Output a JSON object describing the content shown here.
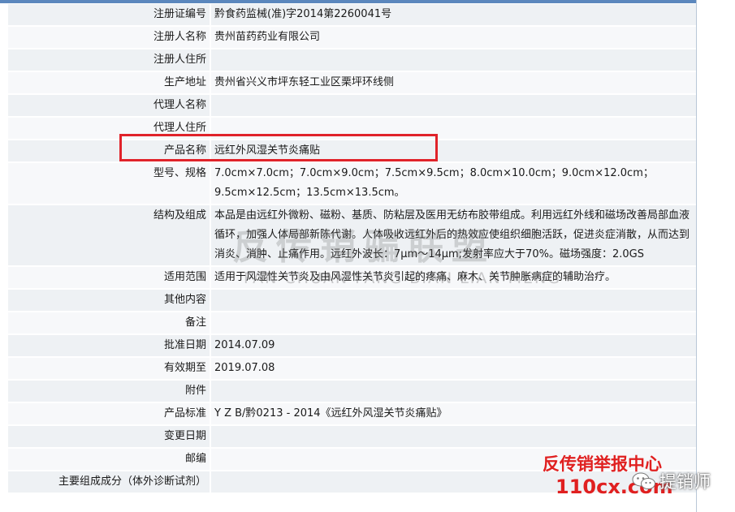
{
  "rows": [
    {
      "label": "注册证编号",
      "value": "黔食药监械(准)字2014第2260041号"
    },
    {
      "label": "注册人名称",
      "value": "贵州苗药药业有限公司"
    },
    {
      "label": "注册人住所",
      "value": ""
    },
    {
      "label": "生产地址",
      "value": "贵州省兴义市坪东轻工业区栗坪环线侧"
    },
    {
      "label": "代理人名称",
      "value": ""
    },
    {
      "label": "代理人住所",
      "value": ""
    },
    {
      "label": "产品名称",
      "value": "远红外风湿关节炎痛贴"
    },
    {
      "label": "型号、规格",
      "value": "7.0cm×7.0cm；7.0cm×9.0cm；7.5cm×9.5cm；8.0cm×10.0cm；9.0cm×12.0cm；9.5cm×12.5cm；13.5cm×13.5cm。"
    },
    {
      "label": "结构及组成",
      "value": "本品是由远红外微粉、磁粉、基质、防粘层及医用无纺布胶带组成。利用远红外线和磁场改善局部血液循环，加强人体局部新陈代谢。人体吸收远红外后的热效应使组织细胞活跃，促进炎症消散，从而达到消炎、消肿、止痛作用。远红外波长：7μm～14μm;发射率应大于70%。磁场强度：2.0GS"
    },
    {
      "label": "适用范围",
      "value": "适用于风湿性关节炎及由风湿性关节炎引起的疼痛、麻木、关节肿胀病症的辅助治疗。"
    },
    {
      "label": "其他内容",
      "value": ""
    },
    {
      "label": "备注",
      "value": ""
    },
    {
      "label": "批准日期",
      "value": "2014.07.09"
    },
    {
      "label": "有效期至",
      "value": "2019.07.08"
    },
    {
      "label": "附件",
      "value": ""
    },
    {
      "label": "产品标准",
      "value": "Y Z B/黔0213 - 2014《远红外风湿关节炎痛贴》"
    },
    {
      "label": "变更日期",
      "value": ""
    },
    {
      "label": "邮编",
      "value": ""
    },
    {
      "label": "主要组成成分（体外诊断试剂）",
      "value": ""
    }
  ],
  "watermark": {
    "title": "反传销骗联盟",
    "pinyin": "FAN CHUAN FANG BIAN LIAN MENG"
  },
  "stamp": {
    "title": "反传销举报中心",
    "url": "110cx.com"
  },
  "brand": {
    "name": "提销师",
    "icon": "wechat-icon"
  },
  "colors": {
    "highlight": "#e0232a",
    "stamp": "#e02020",
    "row_a": "#eef1f4",
    "row_b": "#f7f8fa",
    "topbar": "#5b87bd"
  }
}
